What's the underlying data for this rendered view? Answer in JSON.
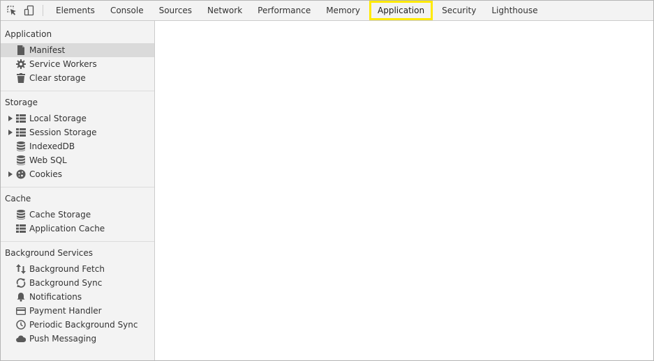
{
  "toolbar": {
    "icons": [
      "inspect-element-icon",
      "device-toggle-icon"
    ],
    "tabs": [
      {
        "label": "Elements",
        "selected": false
      },
      {
        "label": "Console",
        "selected": false
      },
      {
        "label": "Sources",
        "selected": false
      },
      {
        "label": "Network",
        "selected": false
      },
      {
        "label": "Performance",
        "selected": false
      },
      {
        "label": "Memory",
        "selected": false
      },
      {
        "label": "Application",
        "selected": true
      },
      {
        "label": "Security",
        "selected": false
      },
      {
        "label": "Lighthouse",
        "selected": false
      }
    ],
    "highlight_color": "#ffea00"
  },
  "sidebar": {
    "application": {
      "title": "Application",
      "items": {
        "manifest": "Manifest",
        "service_workers": "Service Workers",
        "clear_storage": "Clear storage"
      }
    },
    "storage": {
      "title": "Storage",
      "items": {
        "local_storage": "Local Storage",
        "session_storage": "Session Storage",
        "indexeddb": "IndexedDB",
        "web_sql": "Web SQL",
        "cookies": "Cookies"
      }
    },
    "cache": {
      "title": "Cache",
      "items": {
        "cache_storage": "Cache Storage",
        "application_cache": "Application Cache"
      }
    },
    "background_services": {
      "title": "Background Services",
      "items": {
        "background_fetch": "Background Fetch",
        "background_sync": "Background Sync",
        "notifications": "Notifications",
        "payment_handler": "Payment Handler",
        "periodic_background_sync": "Periodic Background Sync",
        "push_messaging": "Push Messaging"
      }
    }
  }
}
